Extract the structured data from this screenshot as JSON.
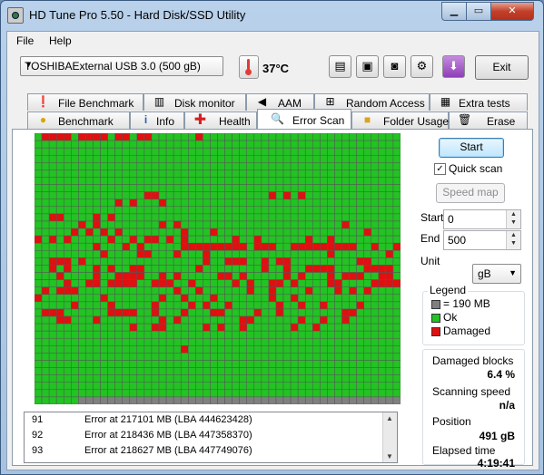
{
  "window": {
    "title": "HD Tune Pro 5.50 - Hard Disk/SSD Utility",
    "min_glyph": "▁",
    "max_glyph": "▭",
    "close_glyph": "✕"
  },
  "menu": [
    "File",
    "Help"
  ],
  "toolbar": {
    "drive": "TOSHIBAExternal USB 3.0 (500 gB)",
    "temperature": "37°C",
    "exit_label": "Exit",
    "icons": [
      "copy-text-icon",
      "copy-screenshot-icon",
      "camera-icon",
      "health-options-icon",
      "download-arrow-icon"
    ]
  },
  "tabs": {
    "row1": [
      {
        "label": "File Benchmark",
        "icon": "file-benchmark-icon"
      },
      {
        "label": "Disk monitor",
        "icon": "disk-monitor-icon"
      },
      {
        "label": "AAM",
        "icon": "speaker-icon"
      },
      {
        "label": "Random Access",
        "icon": "random-access-icon"
      },
      {
        "label": "Extra tests",
        "icon": "extra-tests-icon"
      }
    ],
    "row2": [
      {
        "label": "Benchmark",
        "icon": "lightbulb-icon"
      },
      {
        "label": "Info",
        "icon": "info-icon"
      },
      {
        "label": "Health",
        "icon": "health-cross-icon"
      },
      {
        "label": "Error Scan",
        "icon": "magnifier-icon",
        "active": true
      },
      {
        "label": "Folder Usage",
        "icon": "folder-icon"
      },
      {
        "label": "Erase",
        "icon": "trash-icon"
      }
    ]
  },
  "scan": {
    "cols": 50,
    "rows": 37,
    "unscanned_from_row": 36,
    "unscanned_from_col": 6,
    "damaged": [
      [
        0,
        1
      ],
      [
        0,
        2
      ],
      [
        0,
        3
      ],
      [
        0,
        4
      ],
      [
        0,
        6
      ],
      [
        0,
        7
      ],
      [
        0,
        8
      ],
      [
        0,
        9
      ],
      [
        0,
        11
      ],
      [
        0,
        12
      ],
      [
        0,
        14
      ],
      [
        0,
        15
      ],
      [
        0,
        22
      ],
      [
        8,
        15
      ],
      [
        8,
        16
      ],
      [
        8,
        32
      ],
      [
        8,
        34
      ],
      [
        8,
        36
      ],
      [
        9,
        11
      ],
      [
        9,
        13
      ],
      [
        9,
        17
      ],
      [
        11,
        2
      ],
      [
        11,
        3
      ],
      [
        11,
        8
      ],
      [
        11,
        10
      ],
      [
        12,
        6
      ],
      [
        12,
        8
      ],
      [
        12,
        17
      ],
      [
        12,
        19
      ],
      [
        12,
        42
      ],
      [
        13,
        5
      ],
      [
        13,
        7
      ],
      [
        13,
        9
      ],
      [
        13,
        11
      ],
      [
        13,
        20
      ],
      [
        13,
        24
      ],
      [
        13,
        45
      ],
      [
        14,
        0
      ],
      [
        14,
        2
      ],
      [
        14,
        4
      ],
      [
        14,
        10
      ],
      [
        14,
        13
      ],
      [
        14,
        15
      ],
      [
        14,
        16
      ],
      [
        14,
        18
      ],
      [
        14,
        20
      ],
      [
        14,
        27
      ],
      [
        14,
        30
      ],
      [
        14,
        37
      ],
      [
        14,
        40
      ],
      [
        15,
        8
      ],
      [
        15,
        12
      ],
      [
        15,
        14
      ],
      [
        15,
        20
      ],
      [
        15,
        21
      ],
      [
        15,
        22
      ],
      [
        15,
        23
      ],
      [
        15,
        24
      ],
      [
        15,
        25
      ],
      [
        15,
        26
      ],
      [
        15,
        27
      ],
      [
        15,
        28
      ],
      [
        15,
        30
      ],
      [
        15,
        31
      ],
      [
        15,
        32
      ],
      [
        15,
        35
      ],
      [
        15,
        36
      ],
      [
        15,
        37
      ],
      [
        15,
        38
      ],
      [
        15,
        39
      ],
      [
        15,
        40
      ],
      [
        15,
        41
      ],
      [
        15,
        42
      ],
      [
        15,
        43
      ],
      [
        15,
        46
      ],
      [
        15,
        49
      ],
      [
        16,
        9
      ],
      [
        16,
        14
      ],
      [
        16,
        15
      ],
      [
        16,
        19
      ],
      [
        16,
        23
      ],
      [
        16,
        40
      ],
      [
        16,
        48
      ],
      [
        17,
        2
      ],
      [
        17,
        3
      ],
      [
        17,
        4
      ],
      [
        17,
        6
      ],
      [
        17,
        23
      ],
      [
        17,
        26
      ],
      [
        17,
        27
      ],
      [
        17,
        28
      ],
      [
        17,
        31
      ],
      [
        17,
        33
      ],
      [
        17,
        34
      ],
      [
        17,
        44
      ],
      [
        17,
        45
      ],
      [
        18,
        2
      ],
      [
        18,
        4
      ],
      [
        18,
        8
      ],
      [
        18,
        10
      ],
      [
        18,
        13
      ],
      [
        18,
        14
      ],
      [
        18,
        22
      ],
      [
        18,
        31
      ],
      [
        18,
        34
      ],
      [
        18,
        37
      ],
      [
        18,
        38
      ],
      [
        18,
        39
      ],
      [
        18,
        40
      ],
      [
        18,
        45
      ],
      [
        18,
        46
      ],
      [
        18,
        47
      ],
      [
        18,
        48
      ],
      [
        19,
        3
      ],
      [
        19,
        8
      ],
      [
        19,
        11
      ],
      [
        19,
        12
      ],
      [
        19,
        13
      ],
      [
        19,
        14
      ],
      [
        19,
        17
      ],
      [
        19,
        19
      ],
      [
        19,
        25
      ],
      [
        19,
        26
      ],
      [
        19,
        28
      ],
      [
        19,
        34
      ],
      [
        19,
        36
      ],
      [
        19,
        40
      ],
      [
        19,
        42
      ],
      [
        19,
        43
      ],
      [
        19,
        44
      ],
      [
        19,
        47
      ],
      [
        19,
        48
      ],
      [
        20,
        4
      ],
      [
        20,
        7
      ],
      [
        20,
        8
      ],
      [
        20,
        10
      ],
      [
        20,
        11
      ],
      [
        20,
        12
      ],
      [
        20,
        13
      ],
      [
        20,
        16
      ],
      [
        20,
        17
      ],
      [
        20,
        18
      ],
      [
        20,
        21
      ],
      [
        20,
        27
      ],
      [
        20,
        29
      ],
      [
        20,
        32
      ],
      [
        20,
        33
      ],
      [
        20,
        35
      ],
      [
        20,
        40
      ],
      [
        20,
        41
      ],
      [
        20,
        46
      ],
      [
        20,
        47
      ],
      [
        20,
        48
      ],
      [
        20,
        49
      ],
      [
        21,
        1
      ],
      [
        21,
        3
      ],
      [
        21,
        4
      ],
      [
        21,
        5
      ],
      [
        21,
        19
      ],
      [
        21,
        22
      ],
      [
        21,
        29
      ],
      [
        21,
        32
      ],
      [
        21,
        37
      ],
      [
        21,
        41
      ],
      [
        21,
        43
      ],
      [
        21,
        45
      ],
      [
        22,
        0
      ],
      [
        22,
        9
      ],
      [
        22,
        17
      ],
      [
        22,
        20
      ],
      [
        22,
        24
      ],
      [
        22,
        32
      ],
      [
        22,
        35
      ],
      [
        23,
        5
      ],
      [
        23,
        10
      ],
      [
        23,
        16
      ],
      [
        23,
        21
      ],
      [
        23,
        23
      ],
      [
        23,
        26
      ],
      [
        23,
        33
      ],
      [
        23,
        36
      ],
      [
        23,
        39
      ],
      [
        23,
        44
      ],
      [
        24,
        1
      ],
      [
        24,
        2
      ],
      [
        24,
        3
      ],
      [
        24,
        10
      ],
      [
        24,
        11
      ],
      [
        24,
        12
      ],
      [
        24,
        13
      ],
      [
        24,
        16
      ],
      [
        24,
        20
      ],
      [
        24,
        24
      ],
      [
        24,
        25
      ],
      [
        24,
        30
      ],
      [
        24,
        33
      ],
      [
        24,
        42
      ],
      [
        24,
        43
      ],
      [
        25,
        3
      ],
      [
        25,
        4
      ],
      [
        25,
        8
      ],
      [
        25,
        17
      ],
      [
        25,
        19
      ],
      [
        25,
        28
      ],
      [
        25,
        29
      ],
      [
        25,
        36
      ],
      [
        25,
        39
      ],
      [
        25,
        42
      ],
      [
        26,
        13
      ],
      [
        26,
        16
      ],
      [
        26,
        17
      ],
      [
        26,
        23
      ],
      [
        26,
        25
      ],
      [
        26,
        28
      ],
      [
        26,
        35
      ],
      [
        26,
        38
      ],
      [
        29,
        20
      ]
    ]
  },
  "controls": {
    "start_label": "Start",
    "quick_scan_label": "Quick scan",
    "quick_scan_checked": true,
    "speed_map_label": "Speed map",
    "start_field_label": "Start",
    "start_value": "0",
    "end_field_label": "End",
    "end_value": "500",
    "unit_label": "Unit",
    "unit_value": "gB"
  },
  "legend": {
    "title": "Legend",
    "block": "= 190 MB",
    "ok": "Ok",
    "damaged": "Damaged",
    "colors": {
      "unscanned": "#808080",
      "ok": "#22c322",
      "damaged": "#e01010"
    }
  },
  "stats": {
    "damaged_blocks_label": "Damaged blocks",
    "damaged_blocks": "6.4 %",
    "scanning_speed_label": "Scanning speed",
    "scanning_speed": "n/a",
    "position_label": "Position",
    "position": "491 gB",
    "elapsed_label": "Elapsed time",
    "elapsed": "4:19:41"
  },
  "log": [
    {
      "num": "91",
      "msg": "Error at 217101 MB (LBA 444623428)"
    },
    {
      "num": "92",
      "msg": "Error at 218436 MB (LBA 447358370)"
    },
    {
      "num": "93",
      "msg": "Error at 218627 MB (LBA 447749076)"
    }
  ]
}
